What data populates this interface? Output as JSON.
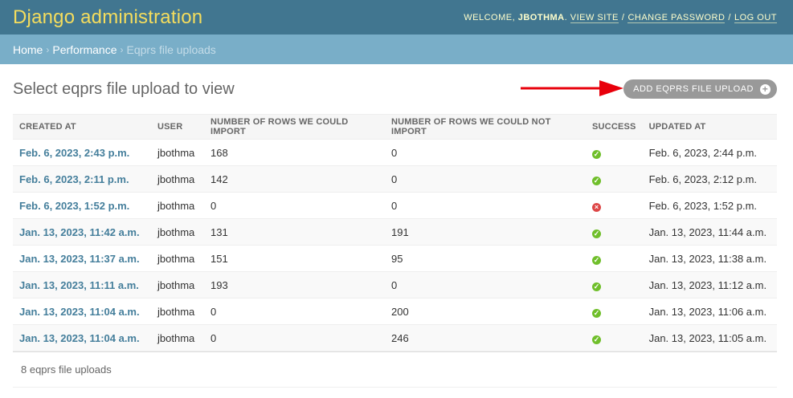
{
  "header": {
    "branding": "Django administration",
    "welcome": "Welcome,",
    "username": "JBOTHMA",
    "view_site": "View site",
    "change_password": "Change password",
    "log_out": "Log out"
  },
  "breadcrumbs": {
    "home": "Home",
    "app": "Performance",
    "current": "Eqprs file uploads"
  },
  "page": {
    "title": "Select eqprs file upload to view",
    "add_button": "Add eqprs file upload"
  },
  "table": {
    "columns": [
      "Created at",
      "User",
      "Number of rows we could import",
      "Number of rows we could not import",
      "Success",
      "Updated at"
    ],
    "rows": [
      {
        "created": "Feb. 6, 2023, 2:43 p.m.",
        "user": "jbothma",
        "imported": "168",
        "not_imported": "0",
        "success": true,
        "updated": "Feb. 6, 2023, 2:44 p.m."
      },
      {
        "created": "Feb. 6, 2023, 2:11 p.m.",
        "user": "jbothma",
        "imported": "142",
        "not_imported": "0",
        "success": true,
        "updated": "Feb. 6, 2023, 2:12 p.m."
      },
      {
        "created": "Feb. 6, 2023, 1:52 p.m.",
        "user": "jbothma",
        "imported": "0",
        "not_imported": "0",
        "success": false,
        "updated": "Feb. 6, 2023, 1:52 p.m."
      },
      {
        "created": "Jan. 13, 2023, 11:42 a.m.",
        "user": "jbothma",
        "imported": "131",
        "not_imported": "191",
        "success": true,
        "updated": "Jan. 13, 2023, 11:44 a.m."
      },
      {
        "created": "Jan. 13, 2023, 11:37 a.m.",
        "user": "jbothma",
        "imported": "151",
        "not_imported": "95",
        "success": true,
        "updated": "Jan. 13, 2023, 11:38 a.m."
      },
      {
        "created": "Jan. 13, 2023, 11:11 a.m.",
        "user": "jbothma",
        "imported": "193",
        "not_imported": "0",
        "success": true,
        "updated": "Jan. 13, 2023, 11:12 a.m."
      },
      {
        "created": "Jan. 13, 2023, 11:04 a.m.",
        "user": "jbothma",
        "imported": "0",
        "not_imported": "200",
        "success": true,
        "updated": "Jan. 13, 2023, 11:06 a.m."
      },
      {
        "created": "Jan. 13, 2023, 11:04 a.m.",
        "user": "jbothma",
        "imported": "0",
        "not_imported": "246",
        "success": true,
        "updated": "Jan. 13, 2023, 11:05 a.m."
      }
    ]
  },
  "paginator": "8 eqprs file uploads",
  "colors": {
    "header_bg": "#417690",
    "branding": "#f5dd5d",
    "breadcrumbs_bg": "#79aec8",
    "link": "#447e9b",
    "success": "#70bf2b",
    "failure": "#dd4646",
    "annotation_arrow": "#e8000b"
  },
  "icons": {
    "success": "check-circle-icon",
    "failure": "x-circle-icon",
    "add": "plus-icon"
  }
}
